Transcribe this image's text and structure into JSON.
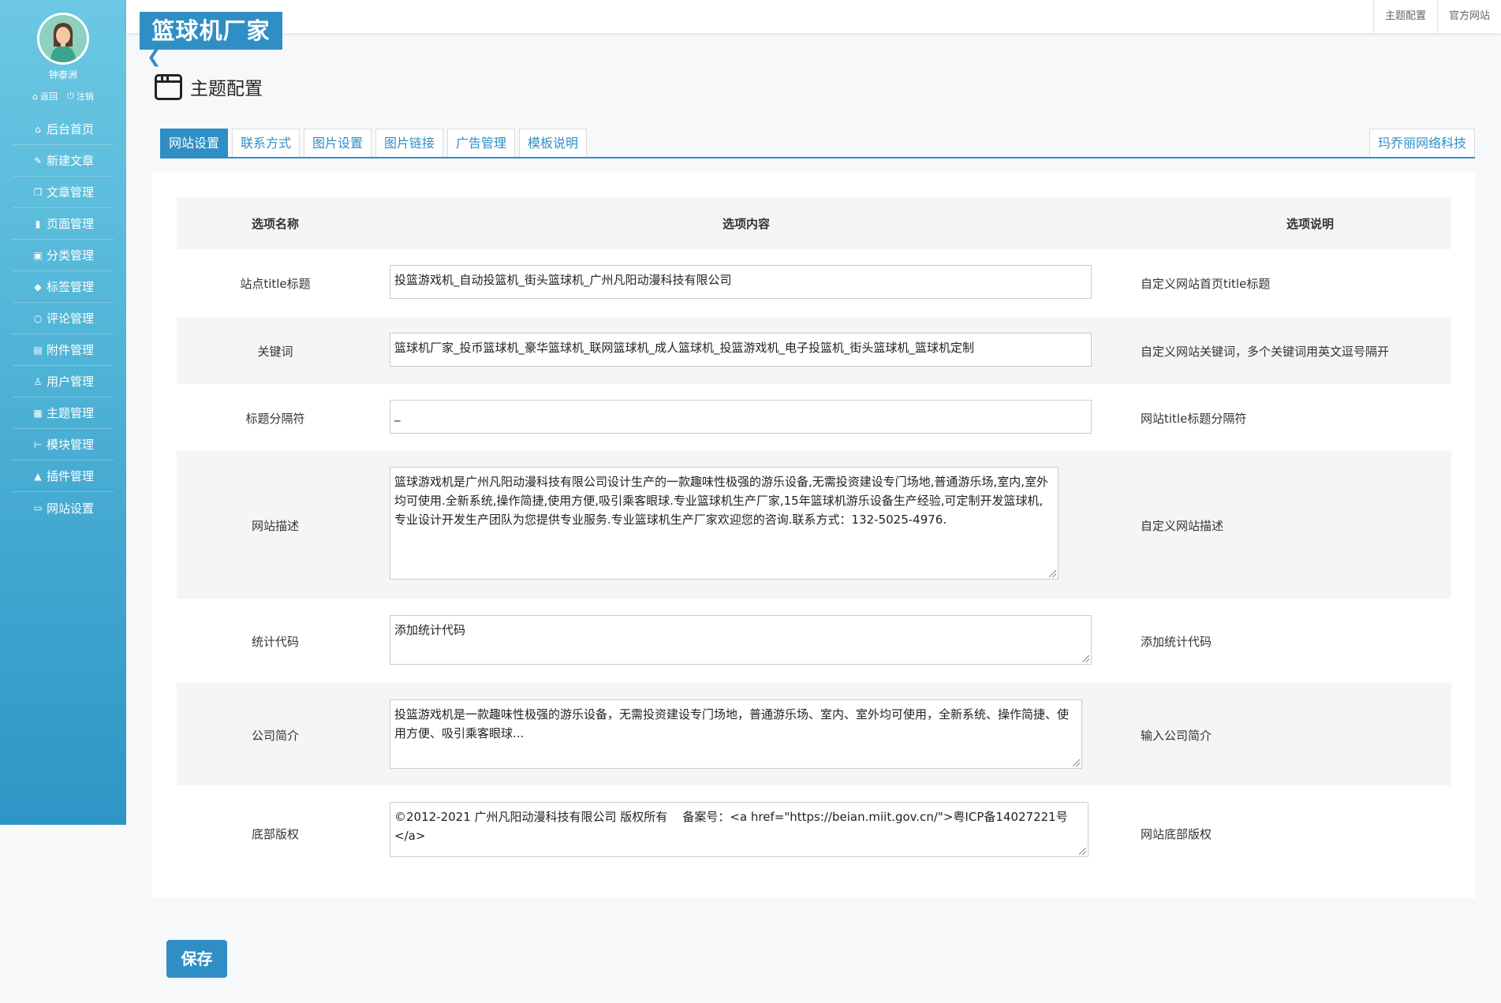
{
  "user": {
    "name": "钟泰洲",
    "back_label": "返回",
    "logout_label": "注销"
  },
  "sidebar": {
    "items": [
      {
        "label": "后台首页",
        "icon": "home-icon"
      },
      {
        "label": "新建文章",
        "icon": "edit-icon"
      },
      {
        "label": "文章管理",
        "icon": "copy-icon"
      },
      {
        "label": "页面管理",
        "icon": "file-icon"
      },
      {
        "label": "分类管理",
        "icon": "folder-icon"
      },
      {
        "label": "标签管理",
        "icon": "tag-icon"
      },
      {
        "label": "评论管理",
        "icon": "comment-icon"
      },
      {
        "label": "附件管理",
        "icon": "hdd-icon"
      },
      {
        "label": "用户管理",
        "icon": "user-icon"
      },
      {
        "label": "主题管理",
        "icon": "theme-icon"
      },
      {
        "label": "模块管理",
        "icon": "module-icon"
      },
      {
        "label": "插件管理",
        "icon": "plugin-icon"
      },
      {
        "label": "网站设置",
        "icon": "window-icon"
      }
    ]
  },
  "topbar": {
    "theme_config_label": "主题配置",
    "official_site_label": "官方网站"
  },
  "logo": {
    "text": "篮球机厂家"
  },
  "page": {
    "title": "主题配置"
  },
  "tabs": {
    "items": [
      "网站设置",
      "联系方式",
      "图片设置",
      "图片链接",
      "广告管理",
      "模板说明"
    ],
    "right": "玛乔丽网络科技"
  },
  "table": {
    "headers": {
      "name": "选项名称",
      "content": "选项内容",
      "desc": "选项说明"
    },
    "rows": [
      {
        "name": "站点title标题",
        "value": "投篮游戏机_自动投篮机_街头篮球机_广州凡阳动漫科技有限公司",
        "desc": "自定义网站首页title标题"
      },
      {
        "name": "关键词",
        "value": "篮球机厂家_投币篮球机_豪华篮球机_联网篮球机_成人篮球机_投篮游戏机_电子投篮机_街头篮球机_篮球机定制",
        "desc": "自定义网站关键词，多个关键词用英文逗号隔开"
      },
      {
        "name": "标题分隔符",
        "value": "_",
        "desc": "网站title标题分隔符"
      },
      {
        "name": "网站描述",
        "value": "篮球游戏机是广州凡阳动漫科技有限公司设计生产的一款趣味性极强的游乐设备,无需投资建设专门场地,普通游乐场,室内,室外均可使用.全新系统,操作简捷,使用方便,吸引乘客眼球.专业篮球机生产厂家,15年篮球机游乐设备生产经验,可定制开发篮球机,专业设计开发生产团队为您提供专业服务.专业篮球机生产厂家欢迎您的咨询.联系方式：132-5025-4976.",
        "desc": "自定义网站描述"
      },
      {
        "name": "统计代码",
        "value": "添加统计代码",
        "desc": "添加统计代码"
      },
      {
        "name": "公司简介",
        "value": "投篮游戏机是一款趣味性极强的游乐设备，无需投资建设专门场地，普通游乐场、室内、室外均可使用，全新系统、操作简捷、使用方便、吸引乘客眼球...",
        "desc": "输入公司简介"
      },
      {
        "name": "底部版权",
        "value": "©2012-2021 广州凡阳动漫科技有限公司 版权所有    备案号：<a href=\"https://beian.miit.gov.cn/\">粤ICP备14027221号</a>",
        "desc": "网站底部版权"
      }
    ]
  },
  "save_label": "保存"
}
